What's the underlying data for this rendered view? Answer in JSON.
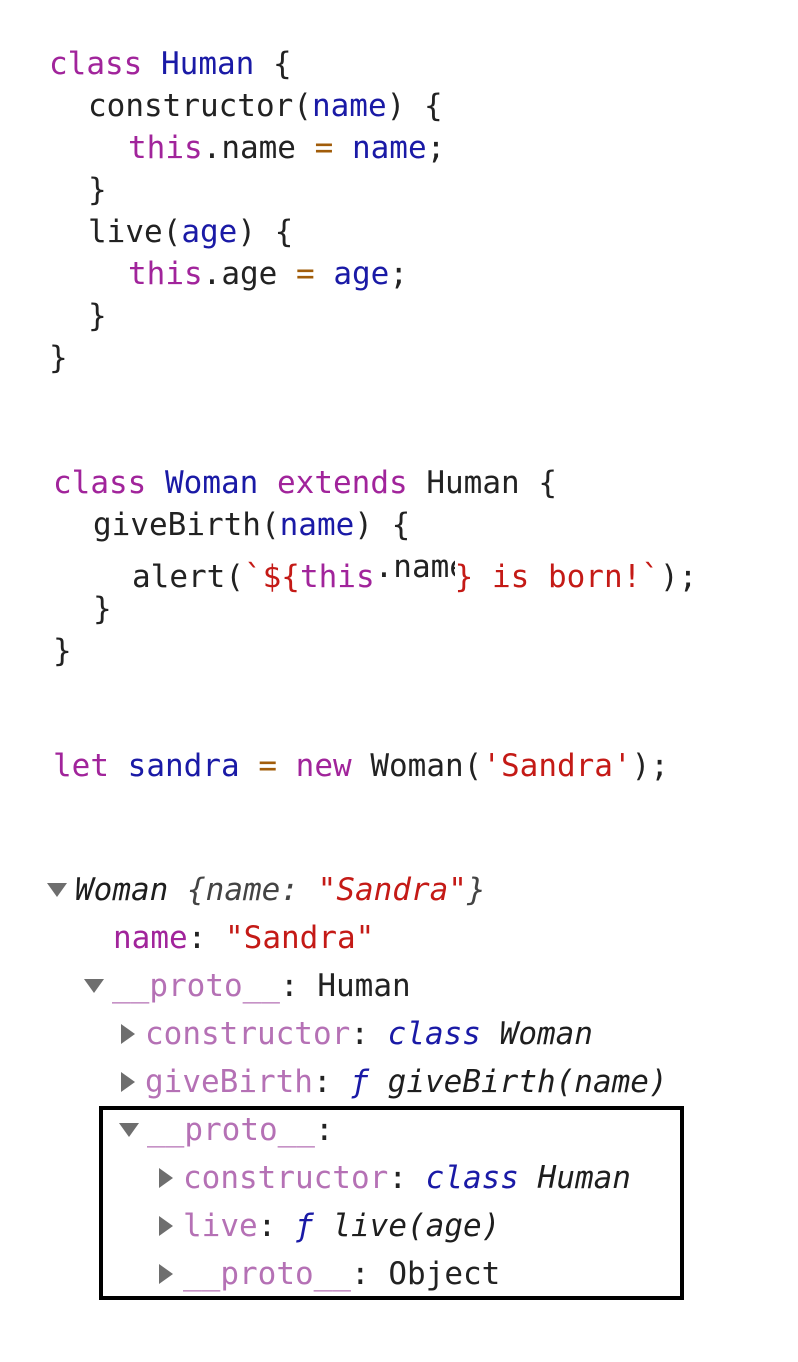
{
  "code": {
    "class_kw": "class",
    "extends_kw": "extends",
    "let_kw": "let",
    "new_kw": "new",
    "this_kw": "this",
    "human": "Human",
    "woman": "Woman",
    "open_brace": " {",
    "close_brace": "}",
    "constructor_fn": "constructor(",
    "name_param": "name",
    "paren_brace": ") {",
    "dot_name": ".name ",
    "eq": "=",
    "semi": ";",
    "live_fn": "live(",
    "age_param": "age",
    "dot_age": ".age ",
    "givebirth_fn": "giveBirth(",
    "alert_open": "alert(",
    "tpl_start": "`${",
    "tpl_end": "} is born!`",
    "alert_close": ");",
    "sandra_var": "sandra",
    "woman_call": "Woman(",
    "sandra_str": "'Sandra'",
    "call_close": ");"
  },
  "console": {
    "root_type": "Woman",
    "root_preview_open": "{name: ",
    "root_preview_value": "\"Sandra\"",
    "root_preview_close": "}",
    "name_key": "name",
    "name_value": "\"Sandra\"",
    "proto_key": "__proto__",
    "colon": ":",
    "proto1_type": "Human",
    "constructor_key": "constructor",
    "class_kw": "class",
    "woman": "Woman",
    "givebirth_key": "giveBirth",
    "f_symbol": "ƒ",
    "givebirth_sig": "giveBirth(name)",
    "human": "Human",
    "live_key": "live",
    "live_sig": "live(age)",
    "object_type": "Object"
  }
}
